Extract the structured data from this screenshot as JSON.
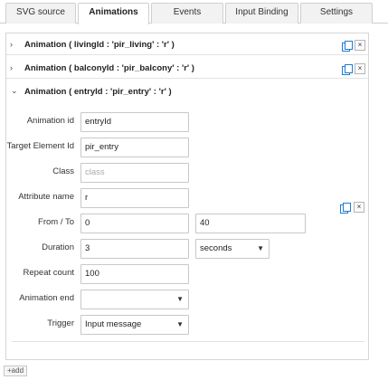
{
  "tabs": [
    {
      "label": "SVG source",
      "active": false
    },
    {
      "label": "Animations",
      "active": true
    },
    {
      "label": "Events",
      "active": false
    },
    {
      "label": "Input Binding",
      "active": false
    },
    {
      "label": "Settings",
      "active": false
    }
  ],
  "animations": [
    {
      "title": "Animation ( livingId : 'pir_living' : 'r' )",
      "expanded": false
    },
    {
      "title": "Animation ( balconyId : 'pir_balcony' : 'r' )",
      "expanded": false
    },
    {
      "title": "Animation ( entryId : 'pir_entry' : 'r' )",
      "expanded": true
    }
  ],
  "icons": {
    "collapsed": "chevron-right-icon",
    "expanded": "chevron-down-icon",
    "copy": "copy-icon",
    "delete": "close-icon",
    "delete_glyph": "×",
    "collapsed_glyph": "›",
    "expanded_glyph": "⌄"
  },
  "form": {
    "animation_id": {
      "label": "Animation id",
      "value": "entryId"
    },
    "target_element_id": {
      "label": "Target Element Id",
      "value": "pir_entry"
    },
    "class": {
      "label": "Class",
      "placeholder": "class"
    },
    "attribute_name": {
      "label": "Attribute name",
      "value": "r"
    },
    "from_to": {
      "label": "From / To",
      "from": "0",
      "to": "40"
    },
    "duration": {
      "label": "Duration",
      "value": "3",
      "unit": "seconds"
    },
    "repeat_count": {
      "label": "Repeat count",
      "value": "100"
    },
    "animation_end": {
      "label": "Animation end",
      "value": ""
    },
    "trigger": {
      "label": "Trigger",
      "value": "Input message"
    }
  },
  "add_button": {
    "label": "add",
    "icon": "plus-icon",
    "glyph": "+"
  },
  "colors": {
    "accent": "#1f7bd6",
    "border": "#cfcfcf"
  }
}
